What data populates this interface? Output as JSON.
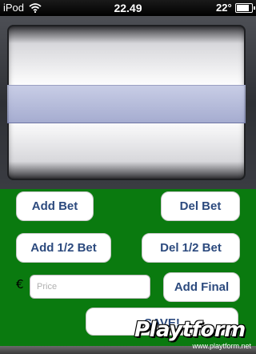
{
  "status_bar": {
    "carrier": "iPod",
    "time": "22.49",
    "temperature": "22°"
  },
  "buttons": {
    "add_bet": "Add Bet",
    "del_bet": "Del Bet",
    "add_half_bet": "Add 1/2 Bet",
    "del_half_bet": "Del 1/2 Bet",
    "add_final": "Add Final",
    "save": "SAVE!"
  },
  "price": {
    "currency_symbol": "€",
    "placeholder": "Price",
    "value": ""
  },
  "watermark": {
    "logo": "Playtform",
    "url": "www.playtform.net"
  },
  "colors": {
    "felt_green": "#0a7a0f",
    "button_text": "#2c4a7e",
    "picker_highlight": "#a9afd6"
  },
  "icons": [
    "wifi-icon",
    "battery-icon"
  ]
}
